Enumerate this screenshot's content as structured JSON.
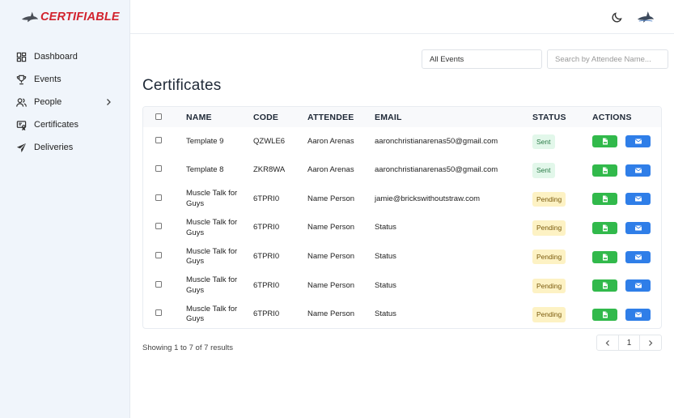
{
  "app": {
    "logo_text": "CERTIFIABLE",
    "logo_icon": "shark-icon",
    "accent_color": "#d2222d"
  },
  "sidebar": {
    "items": [
      {
        "label": "Dashboard",
        "icon": "dashboard-icon"
      },
      {
        "label": "Events",
        "icon": "trophy-icon"
      },
      {
        "label": "People",
        "icon": "users-icon",
        "has_submenu": true
      },
      {
        "label": "Certificates",
        "icon": "certificate-icon"
      },
      {
        "label": "Deliveries",
        "icon": "send-icon"
      }
    ]
  },
  "topbar": {
    "theme_icon": "moon-icon",
    "avatar_icon": "shark-avatar-icon"
  },
  "filters": {
    "event_select_value": "All Events",
    "search_placeholder": "Search by Attendee Name..."
  },
  "page": {
    "title": "Certificates"
  },
  "table": {
    "headers": {
      "name": "NAME",
      "code": "CODE",
      "attendee": "ATTENDEE",
      "email": "EMAIL",
      "status": "STATUS",
      "actions": "ACTIONS"
    },
    "rows": [
      {
        "name": "Template 9",
        "code": "QZWLE6",
        "attendee": "Aaron Arenas",
        "email": "aaronchristianarenas50@gmail.com",
        "status": "Sent"
      },
      {
        "name": "Template 8",
        "code": "ZKR8WA",
        "attendee": "Aaron Arenas",
        "email": "aaronchristianarenas50@gmail.com",
        "status": "Sent"
      },
      {
        "name": "Muscle Talk for Guys",
        "code": "6TPRI0",
        "attendee": "Name Person",
        "email": "jamie@brickswithoutstraw.com",
        "status": "Pending"
      },
      {
        "name": "Muscle Talk for Guys",
        "code": "6TPRI0",
        "attendee": "Name Person",
        "email": "Status",
        "status": "Pending"
      },
      {
        "name": "Muscle Talk for Guys",
        "code": "6TPRI0",
        "attendee": "Name Person",
        "email": "Status",
        "status": "Pending"
      },
      {
        "name": "Muscle Talk for Guys",
        "code": "6TPRI0",
        "attendee": "Name Person",
        "email": "Status",
        "status": "Pending"
      },
      {
        "name": "Muscle Talk for Guys",
        "code": "6TPRI0",
        "attendee": "Name Person",
        "email": "Status",
        "status": "Pending"
      }
    ],
    "status_colors": {
      "Sent": "#e2f7ea",
      "Pending": "#fdf2c4"
    },
    "action_icons": {
      "pdf": "pdf-file-icon",
      "email": "envelope-icon"
    },
    "action_colors": {
      "pdf": "#31b94b",
      "email": "#2f7ee8"
    }
  },
  "pagination": {
    "showing_prefix": "Showing",
    "from": "1",
    "to_word": "to",
    "to": "7",
    "of_word": "of",
    "total": "7",
    "suffix": "results",
    "current_page": "1"
  }
}
